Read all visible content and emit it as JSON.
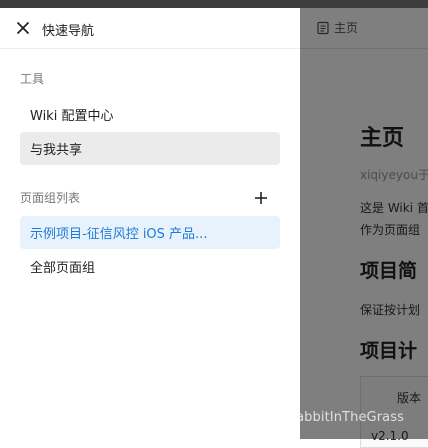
{
  "drawer": {
    "title": "快速导航",
    "tools_label": "工具",
    "tools": [
      {
        "label": "Wiki 配置中心"
      },
      {
        "label": "与我共享"
      }
    ],
    "groups_label": "页面组列表",
    "groups": [
      {
        "label": "示例项目-征信风控 iOS 产品..."
      },
      {
        "label": "全部页面组"
      }
    ]
  },
  "background": {
    "home_label": "主页",
    "title": "主页",
    "user": "xiqiyeyou于",
    "desc_line1": "这是 Wiki 首",
    "desc_line2": "作为页面组",
    "heading_intro": "项目简",
    "para": "保证按计划",
    "heading_plan": "项目计",
    "table_header": "版本",
    "table_cell": "v2.1.0"
  },
  "watermark": "https://blog.csdn.net/RabbitInTheGrass",
  "colors": {
    "active_bg": "#e8f2fc",
    "active_text": "#1f7ad9",
    "hover_bg": "#ebebeb",
    "overlay": "rgba(0,0,0,0.5)"
  }
}
